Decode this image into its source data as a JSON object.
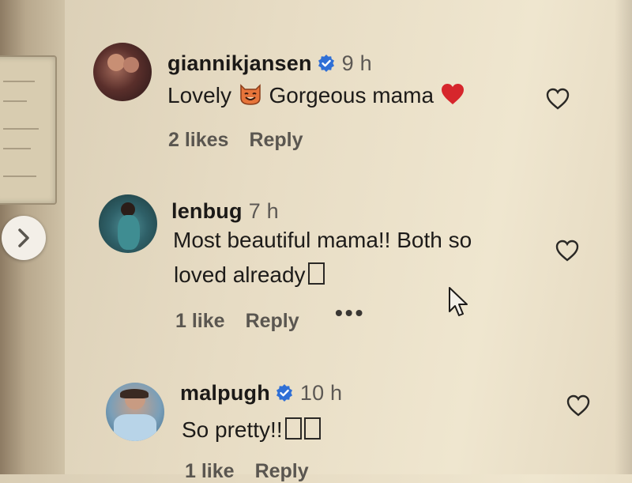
{
  "comments": [
    {
      "username": "giannikjansen",
      "verified": true,
      "time": "9 h",
      "text_parts": [
        "Lovely",
        "Gorgeous mama"
      ],
      "emojis": [
        "smiling-cat-icon",
        "red-heart-icon"
      ],
      "likes": "2 likes",
      "reply": "Reply"
    },
    {
      "username": "lenbug",
      "verified": false,
      "time": "7 h",
      "text_line1": "Most beautiful mama!! Both so",
      "text_line2": "loved already",
      "likes": "1 like",
      "reply": "Reply",
      "more": "•••"
    },
    {
      "username": "malpugh",
      "verified": true,
      "time": "10 h",
      "text": "So pretty!!",
      "likes": "1 like",
      "reply": "Reply"
    }
  ],
  "colors": {
    "verified_blue": "#2f6fd6",
    "heart_red": "#d6262c"
  }
}
